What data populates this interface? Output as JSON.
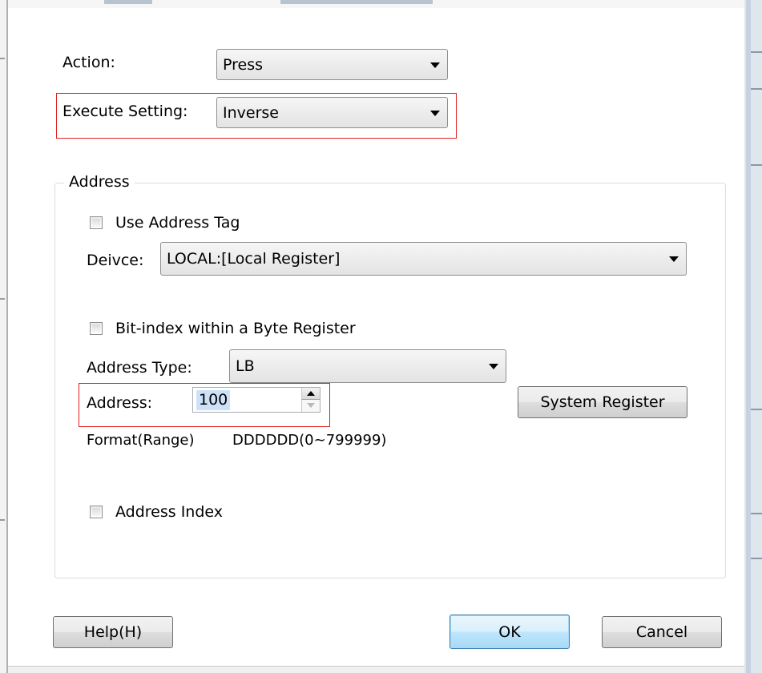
{
  "action": {
    "label": "Action:",
    "value": "Press"
  },
  "execute": {
    "label": "Execute Setting:",
    "value": "Inverse"
  },
  "address_group": {
    "title": "Address",
    "use_address_tag": {
      "label": "Use Address Tag",
      "checked": false
    },
    "device": {
      "label": "Deivce:",
      "value": "LOCAL:[Local Register]"
    },
    "bit_index": {
      "label": "Bit-index within a Byte Register",
      "checked": false
    },
    "address_type": {
      "label": "Address Type:",
      "value": "LB"
    },
    "address": {
      "label": "Address:",
      "value": "100"
    },
    "system_register_button": "System Register",
    "format_label": "Format(Range)",
    "format_value": "DDDDDD(0~799999)",
    "address_index": {
      "label": "Address Index",
      "checked": false
    }
  },
  "buttons": {
    "help": "Help(H)",
    "ok": "OK",
    "cancel": "Cancel"
  },
  "colors": {
    "highlight_border": "#e02020",
    "selection": "#cde2f8",
    "default_button": "#3c7fb1"
  }
}
